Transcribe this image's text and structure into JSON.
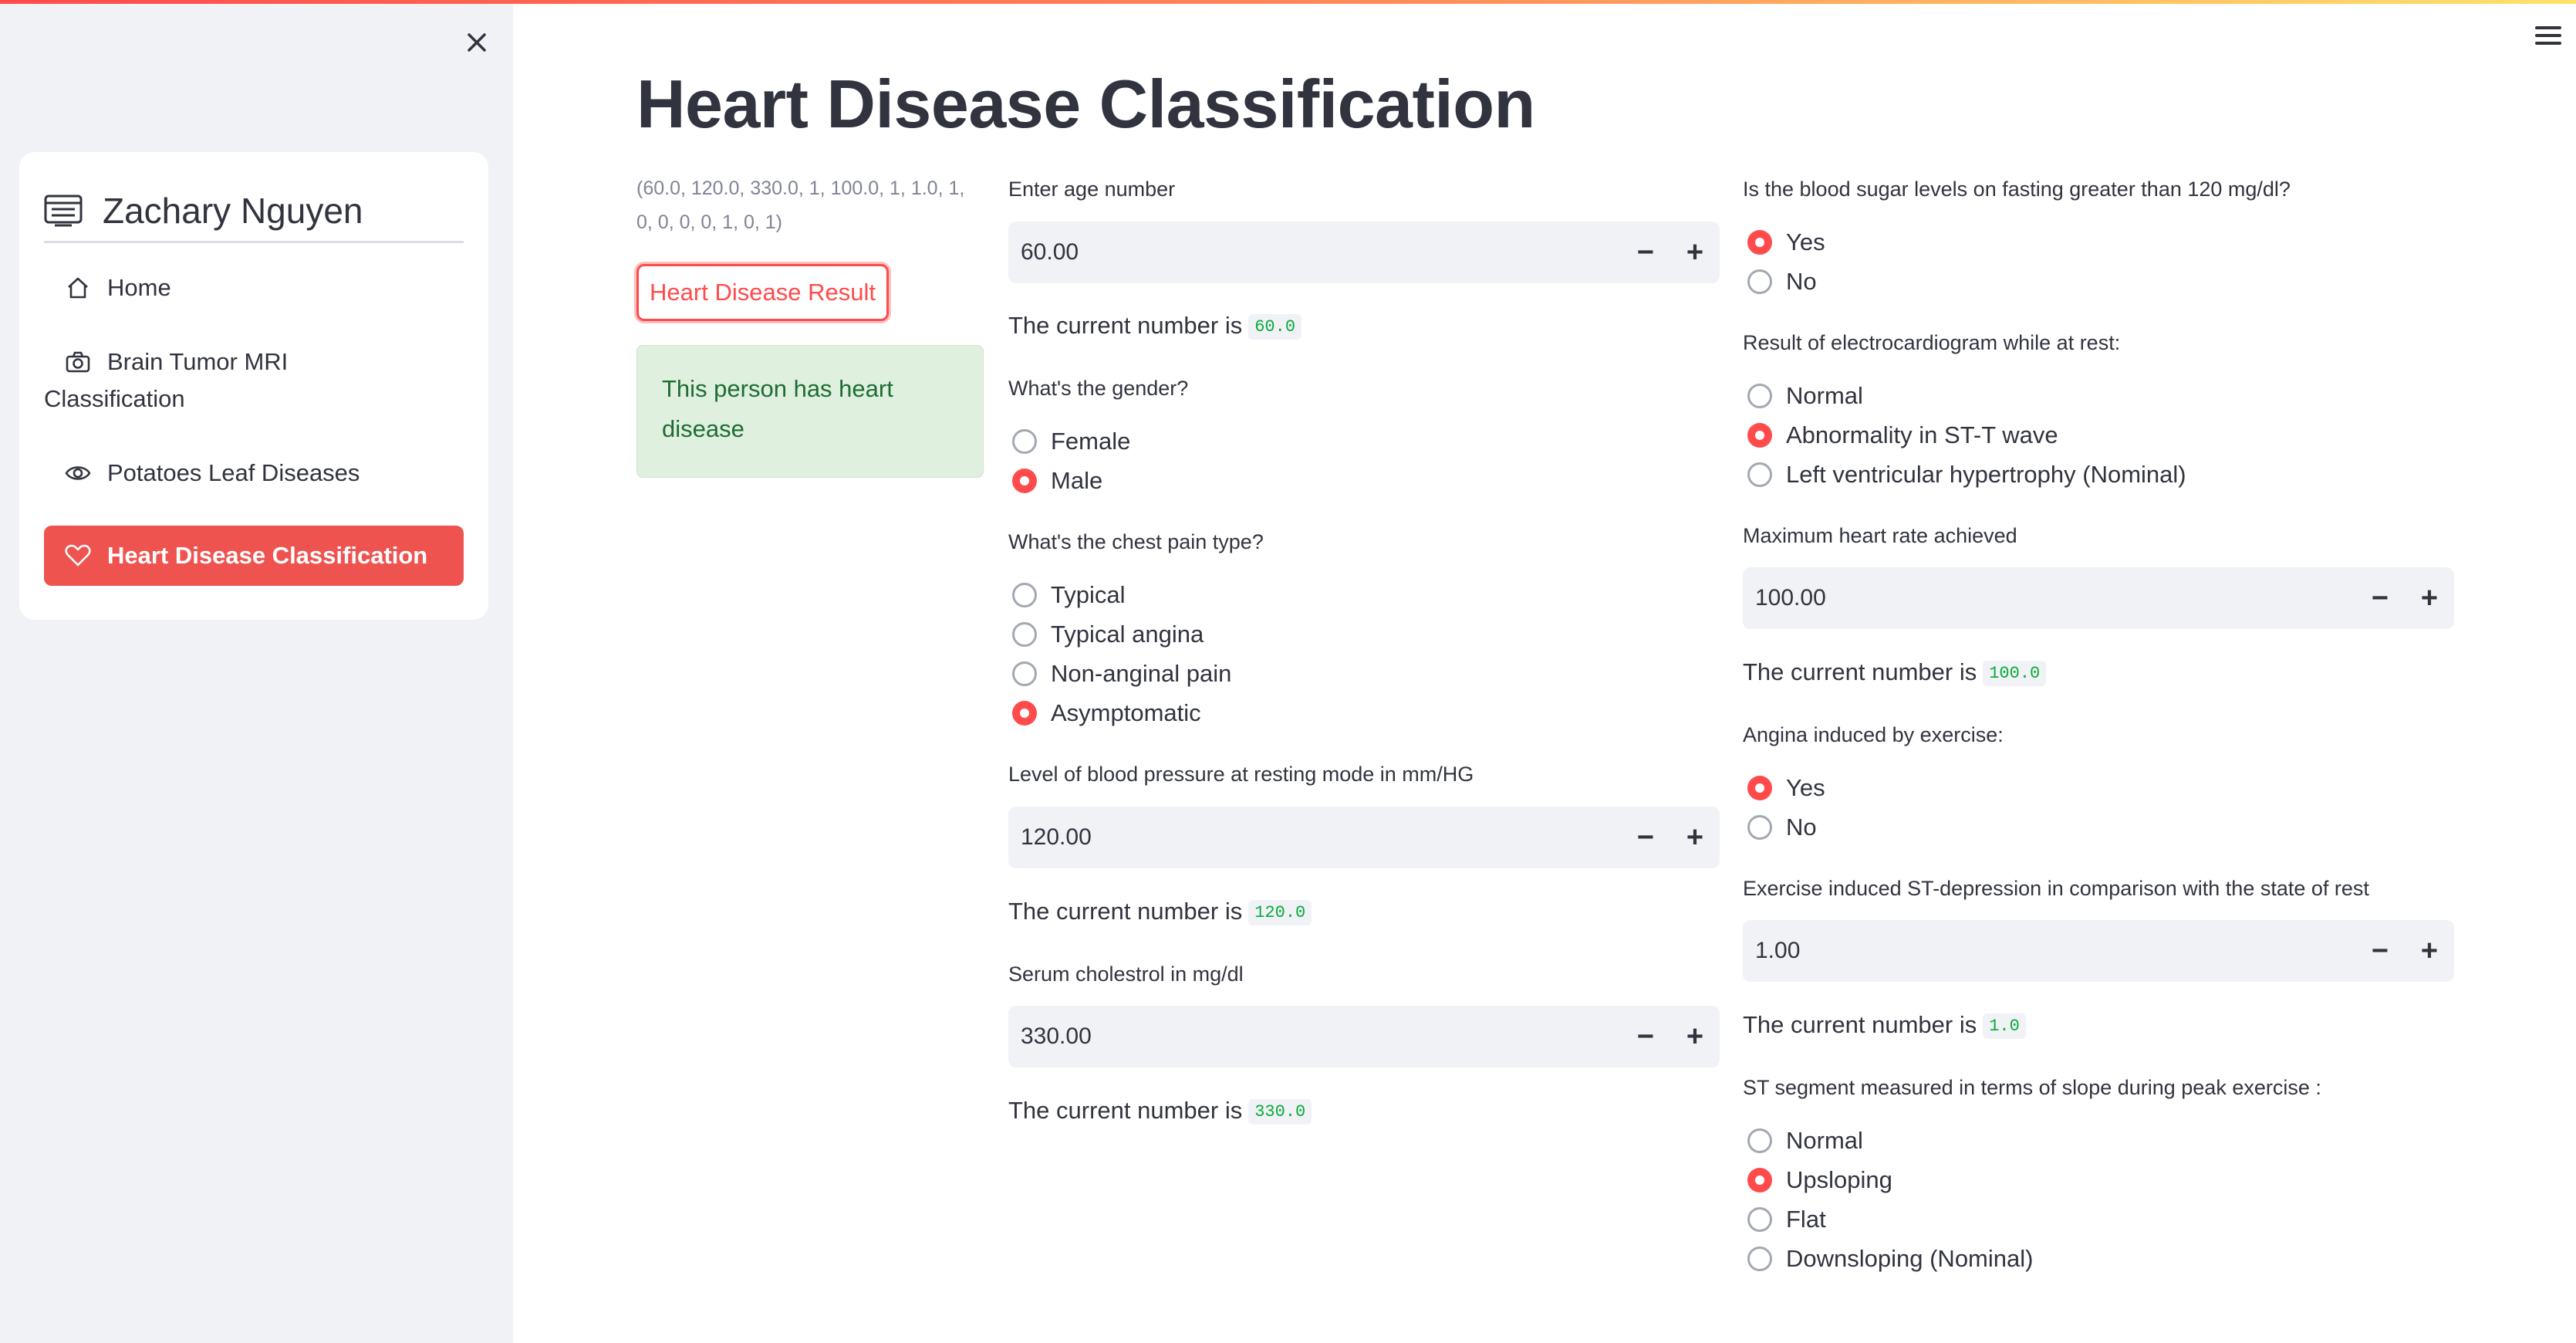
{
  "sidebar": {
    "app_name": "Zachary Nguyen",
    "items": [
      {
        "label": "Home"
      },
      {
        "label": "Brain Tumor MRI Classification"
      },
      {
        "label": "Potatoes Leaf Diseases"
      },
      {
        "label": "Heart Disease Classification"
      }
    ],
    "active_item": "Heart Disease Classification"
  },
  "main": {
    "title": "Heart Disease Classification",
    "input_vector": "(60.0, 120.0, 330.0, 1, 100.0, 1, 1.0, 1, 0, 0, 0, 0, 1, 0, 1)",
    "result_button": "Heart Disease Result",
    "result_message": "This person has heart disease",
    "current_number_prefix": "The current number is",
    "step_minus": "−",
    "step_plus": "+",
    "age": {
      "label": "Enter age number",
      "value": "60.00",
      "current": "60.0"
    },
    "gender": {
      "label": "What's the gender?",
      "options": [
        "Female",
        "Male"
      ],
      "selected": "Male"
    },
    "chest_pain": {
      "label": "What's the chest pain type?",
      "options": [
        "Typical",
        "Typical angina",
        "Non-anginal pain",
        "Asymptomatic"
      ],
      "selected": "Asymptomatic"
    },
    "blood_pressure": {
      "label": "Level of blood pressure at resting mode in mm/HG",
      "value": "120.00",
      "current": "120.0"
    },
    "cholesterol": {
      "label": "Serum cholestrol in mg/dl",
      "value": "330.00",
      "current": "330.0"
    },
    "blood_sugar": {
      "label": "Is the blood sugar levels on fasting greater than 120 mg/dl?",
      "options": [
        "Yes",
        "No"
      ],
      "selected": "Yes"
    },
    "ecg": {
      "label": "Result of electrocardiogram while at rest:",
      "options": [
        "Normal",
        "Abnormality in ST-T wave",
        "Left ventricular hypertrophy (Nominal)"
      ],
      "selected": "Abnormality in ST-T wave"
    },
    "max_heart_rate": {
      "label": "Maximum heart rate achieved",
      "value": "100.00",
      "current": "100.0"
    },
    "angina": {
      "label": "Angina induced by exercise:",
      "options": [
        "Yes",
        "No"
      ],
      "selected": "Yes"
    },
    "st_depression": {
      "label": "Exercise induced ST-depression in comparison with the state of rest",
      "value": "1.00",
      "current": "1.0"
    },
    "st_slope": {
      "label": "ST segment measured in terms of slope during peak exercise :",
      "options": [
        "Normal",
        "Upsloping",
        "Flat",
        "Downsloping (Nominal)"
      ],
      "selected": "Upsloping"
    }
  },
  "colors": {
    "accent": "#ff4b4b",
    "active_nav": "#ee5350",
    "success_bg": "#dff0de",
    "success_text": "#1d6c35",
    "code_text": "#09ab3b"
  },
  "icons": {
    "close": "close-icon",
    "menu": "hamburger-menu-icon",
    "brand": "list-card-icon",
    "home": "house-icon",
    "brain": "camera-icon",
    "potato": "eye-icon",
    "heart": "heart-icon"
  }
}
